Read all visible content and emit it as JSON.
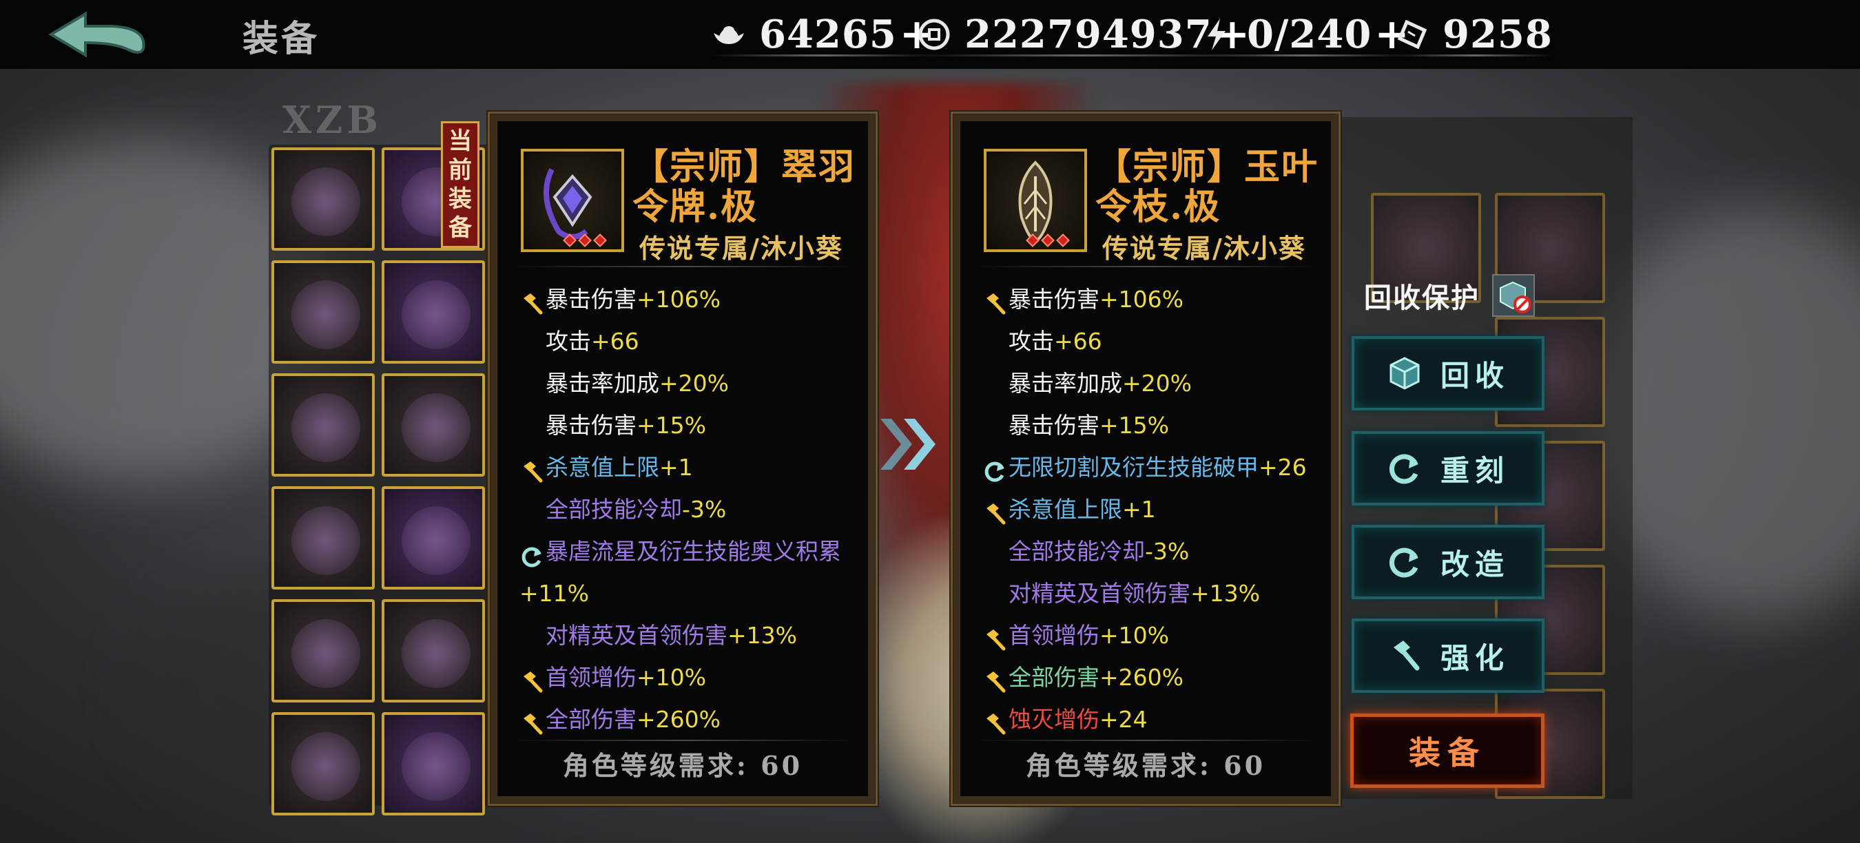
{
  "header": {
    "title": "装备",
    "resources": [
      {
        "icon": "silver-ingot-icon",
        "value": "64265"
      },
      {
        "icon": "coin-icon",
        "value": "222794937"
      },
      {
        "icon": "lightning-icon",
        "value": "0/240"
      },
      {
        "icon": "ticket-icon",
        "value": "9258"
      }
    ]
  },
  "current_tag": [
    "当",
    "前",
    "装",
    "备"
  ],
  "left_card": {
    "name_line1": "【宗师】翠羽",
    "name_line2": "令牌.极",
    "subtitle": "传说专属/沐小葵",
    "stats": [
      {
        "icon": "hammer",
        "label": "暴击伤害",
        "value": "+106%",
        "label_color": "white"
      },
      {
        "icon": "",
        "label": "攻击",
        "value": "+66",
        "label_color": "white"
      },
      {
        "icon": "",
        "label": "暴击率加成",
        "value": "+20%",
        "label_color": "white"
      },
      {
        "icon": "",
        "label": "暴击伤害",
        "value": "+15%",
        "label_color": "white"
      },
      {
        "icon": "hammer",
        "label": "杀意值上限",
        "value": "+1",
        "label_color": "blue"
      },
      {
        "icon": "",
        "label": "全部技能冷却",
        "value": "-3%",
        "label_color": "purple"
      },
      {
        "icon": "reforge",
        "label": "暴虐流星及衍生技能奥义积累",
        "value": "+11%",
        "label_color": "purple",
        "wrap": true
      },
      {
        "icon": "",
        "label": "对精英及首领伤害",
        "value": "+13%",
        "label_color": "purple"
      },
      {
        "icon": "hammer",
        "label": "首领增伤",
        "value": "+10%",
        "label_color": "purple"
      },
      {
        "icon": "hammer",
        "label": "全部伤害",
        "value": "+260%",
        "label_color": "purple"
      }
    ],
    "requirement": "角色等级需求: 60"
  },
  "right_card": {
    "name_line1": "【宗师】玉叶",
    "name_line2": "令枝.极",
    "subtitle": "传说专属/沐小葵",
    "stats": [
      {
        "icon": "hammer",
        "label": "暴击伤害",
        "value": "+106%",
        "label_color": "white"
      },
      {
        "icon": "",
        "label": "攻击",
        "value": "+66",
        "label_color": "white"
      },
      {
        "icon": "",
        "label": "暴击率加成",
        "value": "+20%",
        "label_color": "white"
      },
      {
        "icon": "",
        "label": "暴击伤害",
        "value": "+15%",
        "label_color": "white"
      },
      {
        "icon": "reforge",
        "label": "无限切割及衍生技能破甲",
        "value": "+26",
        "label_color": "blue"
      },
      {
        "icon": "hammer",
        "label": "杀意值上限",
        "value": "+1",
        "label_color": "blue"
      },
      {
        "icon": "",
        "label": "全部技能冷却",
        "value": "-3%",
        "label_color": "purple"
      },
      {
        "icon": "",
        "label": "对精英及首领伤害",
        "value": "+13%",
        "label_color": "purple"
      },
      {
        "icon": "hammer",
        "label": "首领增伤",
        "value": "+10%",
        "label_color": "purple"
      },
      {
        "icon": "hammer",
        "label": "全部伤害",
        "value": "+260%",
        "label_color": "green"
      },
      {
        "icon": "hammer",
        "label": "蚀灭增伤",
        "value": "+24",
        "label_color": "red"
      }
    ],
    "requirement": "角色等级需求: 60"
  },
  "actions": {
    "recycle_protect_label": "回收保护",
    "recycle": "回收",
    "reengrave": "重刻",
    "remodel": "改造",
    "enhance": "强化",
    "equip": "装备"
  },
  "colors": {
    "white": "#f3f3f3",
    "blue": "#67b8ea",
    "purple": "#a07be8",
    "green": "#7fd4a4",
    "red": "#ee4b40",
    "value_yellow": "#eddc46",
    "title_orange": "#f0a63a",
    "equip_orange": "#c8541c"
  }
}
